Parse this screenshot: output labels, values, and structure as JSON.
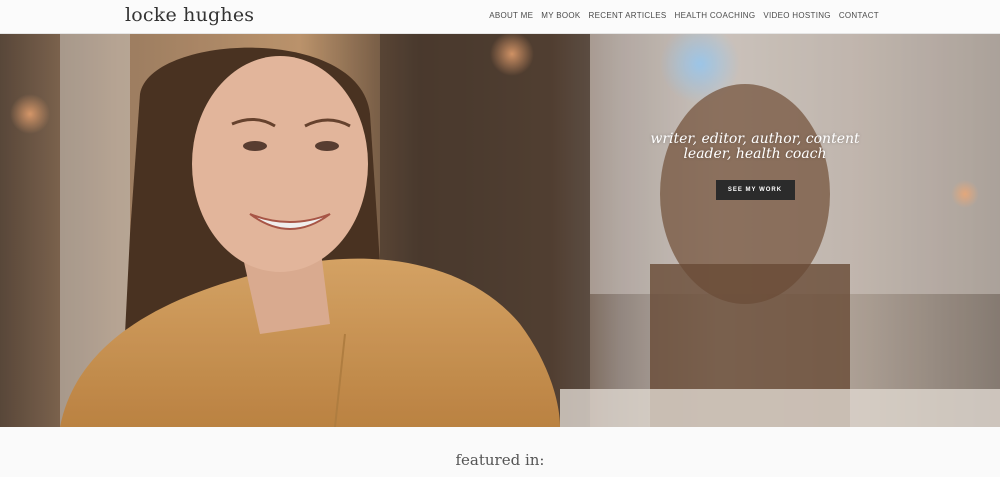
{
  "site": {
    "logo": "locke hughes"
  },
  "nav": {
    "items": [
      {
        "label": "ABOUT ME"
      },
      {
        "label": "MY BOOK"
      },
      {
        "label": "RECENT ARTICLES"
      },
      {
        "label": "HEALTH COACHING"
      },
      {
        "label": "VIDEO HOSTING"
      },
      {
        "label": "CONTACT"
      }
    ]
  },
  "hero": {
    "tagline_line1": "writer, editor, author, content",
    "tagline_line2": "leader, health coach",
    "cta_label": "SEE MY WORK"
  },
  "featured": {
    "heading": "featured in:"
  },
  "colors": {
    "cta_bg": "#2b2b2b",
    "header_bg": "#fbfbfb",
    "text": "#4a4a4a"
  }
}
